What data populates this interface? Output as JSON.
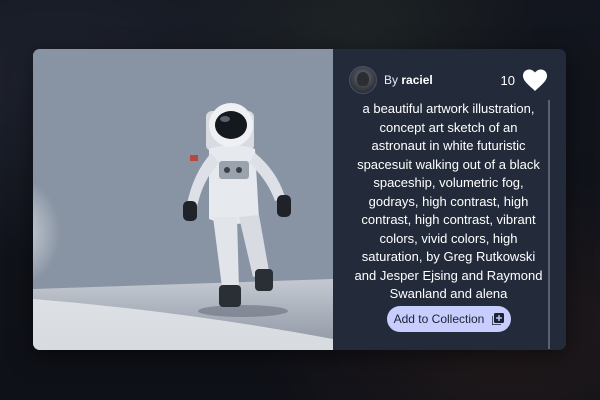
{
  "author": {
    "prefix": "By",
    "name": "raciel"
  },
  "likes": {
    "count": "10",
    "icon": "heart-icon"
  },
  "image": {
    "alt": "astronaut walking",
    "subject_icon": "astronaut-illustration"
  },
  "prompt": {
    "text": "a beautiful artwork illustration, concept art sketch of an astronaut in white futuristic spacesuit walking out of a black spaceship, volumetric fog, godrays, high contrast, high contrast, high contrast, vibrant colors, vivid colors, high saturation, by Greg Rutkowski and Jesper Ejsing and Raymond Swanland and alena"
  },
  "actions": {
    "add_to_collection_label": "Add to Collection",
    "add_icon": "add-box-icon"
  },
  "colors": {
    "panel_bg": "#232b3b",
    "button_bg": "#c7cdfd"
  }
}
